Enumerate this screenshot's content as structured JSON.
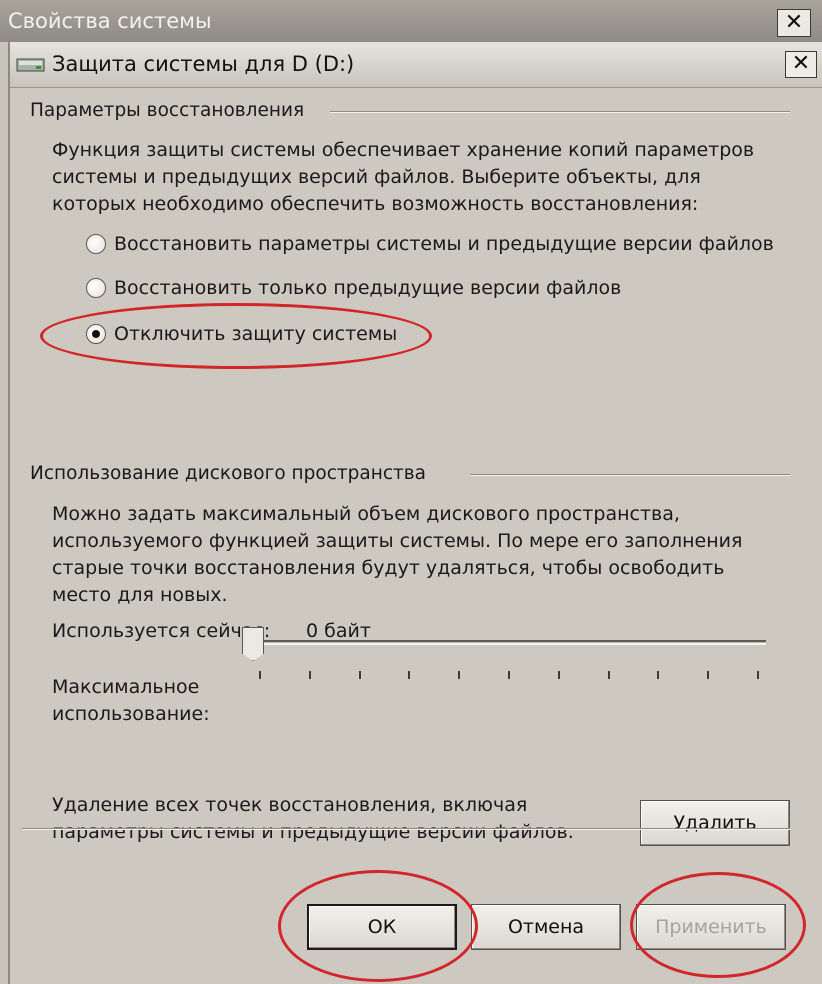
{
  "parent_window": {
    "title": "Свойства системы",
    "close_glyph": "✕"
  },
  "dialog": {
    "title": "Защита системы для D (D:)",
    "close_glyph": "✕",
    "icon": "drive-icon"
  },
  "restore_section": {
    "label": "Параметры восстановления",
    "description": [
      "Функция защиты системы обеспечивает хранение копий параметров",
      "системы и предыдущих версий файлов. Выберите объекты, для",
      "которых необходимо обеспечить возможность восстановления:"
    ],
    "options": [
      {
        "label": "Восстановить параметры системы и предыдущие версии файлов",
        "checked": false
      },
      {
        "label": "Восстановить только предыдущие версии файлов",
        "checked": false
      },
      {
        "label": "Отключить защиту системы",
        "checked": true
      }
    ]
  },
  "disk_section": {
    "label": "Использование дискового пространства",
    "description": [
      "Можно задать максимальный объем дискового пространства,",
      "используемого функцией защиты системы. По мере его заполнения",
      "старые точки восстановления будут удаляться, чтобы освободить",
      "место для новых."
    ],
    "current_usage_label": "Используется сейчас:",
    "current_usage_value": "0 байт",
    "max_usage_label_line1": "Максимальное",
    "max_usage_label_line2": "использование:",
    "max_usage_level": 0,
    "tick_count": 11,
    "delete_text_line1": "Удаление всех точек восстановления, включая",
    "delete_text_line2": "параметры системы и предыдущие версии файлов.",
    "delete_button": "Удалить"
  },
  "buttons": {
    "ok": "ОК",
    "cancel": "Отмена",
    "apply": "Применить"
  },
  "colors": {
    "annotation": "#d3262a",
    "dialog_bg": "#cdc9c1"
  }
}
